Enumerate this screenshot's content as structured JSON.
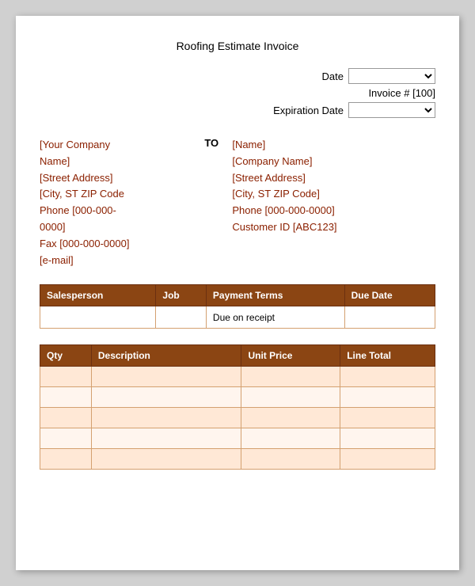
{
  "title": "Roofing Estimate Invoice",
  "header": {
    "date_label": "Date",
    "invoice_num": "Invoice # [100]",
    "expiration_label": "Expiration Date"
  },
  "from_address": {
    "line1": "[Your Company",
    "line2": "Name]",
    "line3": "[Street Address]",
    "line4": "[City, ST  ZIP Code",
    "line5": "Phone [000-000-",
    "line6": "0000]",
    "line7": "Fax [000-000-0000]",
    "line8": "[e-mail]"
  },
  "to_label": "TO",
  "to_address": {
    "line1": "[Name]",
    "line2": "[Company Name]",
    "line3": "[Street Address]",
    "line4": "[City, ST  ZIP Code]",
    "line5": "Phone [000-000-0000]",
    "line6": "Customer ID [ABC123]"
  },
  "sales_table": {
    "headers": [
      "Salesperson",
      "Job",
      "Payment Terms",
      "Due Date"
    ],
    "row": {
      "salesperson": "",
      "job": "",
      "payment_terms": "Due on receipt",
      "due_date": ""
    }
  },
  "items_table": {
    "headers": [
      "Qty",
      "Description",
      "Unit Price",
      "Line Total"
    ],
    "rows": [
      {
        "qty": "",
        "description": "",
        "unit_price": "",
        "line_total": ""
      },
      {
        "qty": "",
        "description": "",
        "unit_price": "",
        "line_total": ""
      },
      {
        "qty": "",
        "description": "",
        "unit_price": "",
        "line_total": ""
      },
      {
        "qty": "",
        "description": "",
        "unit_price": "",
        "line_total": ""
      },
      {
        "qty": "",
        "description": "",
        "unit_price": "",
        "line_total": ""
      }
    ]
  }
}
